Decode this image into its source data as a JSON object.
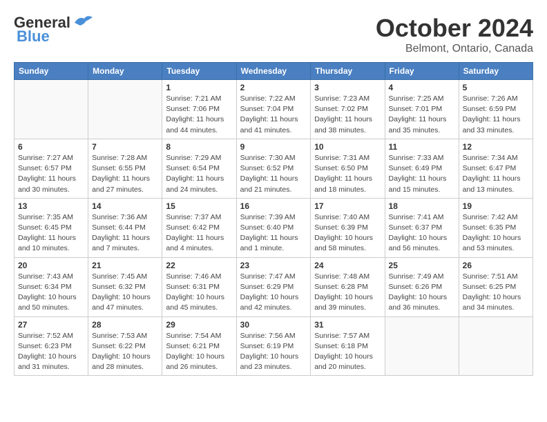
{
  "header": {
    "logo_main": "General",
    "logo_sub": "Blue",
    "month": "October 2024",
    "location": "Belmont, Ontario, Canada"
  },
  "weekdays": [
    "Sunday",
    "Monday",
    "Tuesday",
    "Wednesday",
    "Thursday",
    "Friday",
    "Saturday"
  ],
  "weeks": [
    [
      {
        "day": "",
        "info": ""
      },
      {
        "day": "",
        "info": ""
      },
      {
        "day": "1",
        "info": "Sunrise: 7:21 AM\nSunset: 7:06 PM\nDaylight: 11 hours and 44 minutes."
      },
      {
        "day": "2",
        "info": "Sunrise: 7:22 AM\nSunset: 7:04 PM\nDaylight: 11 hours and 41 minutes."
      },
      {
        "day": "3",
        "info": "Sunrise: 7:23 AM\nSunset: 7:02 PM\nDaylight: 11 hours and 38 minutes."
      },
      {
        "day": "4",
        "info": "Sunrise: 7:25 AM\nSunset: 7:01 PM\nDaylight: 11 hours and 35 minutes."
      },
      {
        "day": "5",
        "info": "Sunrise: 7:26 AM\nSunset: 6:59 PM\nDaylight: 11 hours and 33 minutes."
      }
    ],
    [
      {
        "day": "6",
        "info": "Sunrise: 7:27 AM\nSunset: 6:57 PM\nDaylight: 11 hours and 30 minutes."
      },
      {
        "day": "7",
        "info": "Sunrise: 7:28 AM\nSunset: 6:55 PM\nDaylight: 11 hours and 27 minutes."
      },
      {
        "day": "8",
        "info": "Sunrise: 7:29 AM\nSunset: 6:54 PM\nDaylight: 11 hours and 24 minutes."
      },
      {
        "day": "9",
        "info": "Sunrise: 7:30 AM\nSunset: 6:52 PM\nDaylight: 11 hours and 21 minutes."
      },
      {
        "day": "10",
        "info": "Sunrise: 7:31 AM\nSunset: 6:50 PM\nDaylight: 11 hours and 18 minutes."
      },
      {
        "day": "11",
        "info": "Sunrise: 7:33 AM\nSunset: 6:49 PM\nDaylight: 11 hours and 15 minutes."
      },
      {
        "day": "12",
        "info": "Sunrise: 7:34 AM\nSunset: 6:47 PM\nDaylight: 11 hours and 13 minutes."
      }
    ],
    [
      {
        "day": "13",
        "info": "Sunrise: 7:35 AM\nSunset: 6:45 PM\nDaylight: 11 hours and 10 minutes."
      },
      {
        "day": "14",
        "info": "Sunrise: 7:36 AM\nSunset: 6:44 PM\nDaylight: 11 hours and 7 minutes."
      },
      {
        "day": "15",
        "info": "Sunrise: 7:37 AM\nSunset: 6:42 PM\nDaylight: 11 hours and 4 minutes."
      },
      {
        "day": "16",
        "info": "Sunrise: 7:39 AM\nSunset: 6:40 PM\nDaylight: 11 hours and 1 minute."
      },
      {
        "day": "17",
        "info": "Sunrise: 7:40 AM\nSunset: 6:39 PM\nDaylight: 10 hours and 58 minutes."
      },
      {
        "day": "18",
        "info": "Sunrise: 7:41 AM\nSunset: 6:37 PM\nDaylight: 10 hours and 56 minutes."
      },
      {
        "day": "19",
        "info": "Sunrise: 7:42 AM\nSunset: 6:35 PM\nDaylight: 10 hours and 53 minutes."
      }
    ],
    [
      {
        "day": "20",
        "info": "Sunrise: 7:43 AM\nSunset: 6:34 PM\nDaylight: 10 hours and 50 minutes."
      },
      {
        "day": "21",
        "info": "Sunrise: 7:45 AM\nSunset: 6:32 PM\nDaylight: 10 hours and 47 minutes."
      },
      {
        "day": "22",
        "info": "Sunrise: 7:46 AM\nSunset: 6:31 PM\nDaylight: 10 hours and 45 minutes."
      },
      {
        "day": "23",
        "info": "Sunrise: 7:47 AM\nSunset: 6:29 PM\nDaylight: 10 hours and 42 minutes."
      },
      {
        "day": "24",
        "info": "Sunrise: 7:48 AM\nSunset: 6:28 PM\nDaylight: 10 hours and 39 minutes."
      },
      {
        "day": "25",
        "info": "Sunrise: 7:49 AM\nSunset: 6:26 PM\nDaylight: 10 hours and 36 minutes."
      },
      {
        "day": "26",
        "info": "Sunrise: 7:51 AM\nSunset: 6:25 PM\nDaylight: 10 hours and 34 minutes."
      }
    ],
    [
      {
        "day": "27",
        "info": "Sunrise: 7:52 AM\nSunset: 6:23 PM\nDaylight: 10 hours and 31 minutes."
      },
      {
        "day": "28",
        "info": "Sunrise: 7:53 AM\nSunset: 6:22 PM\nDaylight: 10 hours and 28 minutes."
      },
      {
        "day": "29",
        "info": "Sunrise: 7:54 AM\nSunset: 6:21 PM\nDaylight: 10 hours and 26 minutes."
      },
      {
        "day": "30",
        "info": "Sunrise: 7:56 AM\nSunset: 6:19 PM\nDaylight: 10 hours and 23 minutes."
      },
      {
        "day": "31",
        "info": "Sunrise: 7:57 AM\nSunset: 6:18 PM\nDaylight: 10 hours and 20 minutes."
      },
      {
        "day": "",
        "info": ""
      },
      {
        "day": "",
        "info": ""
      }
    ]
  ]
}
